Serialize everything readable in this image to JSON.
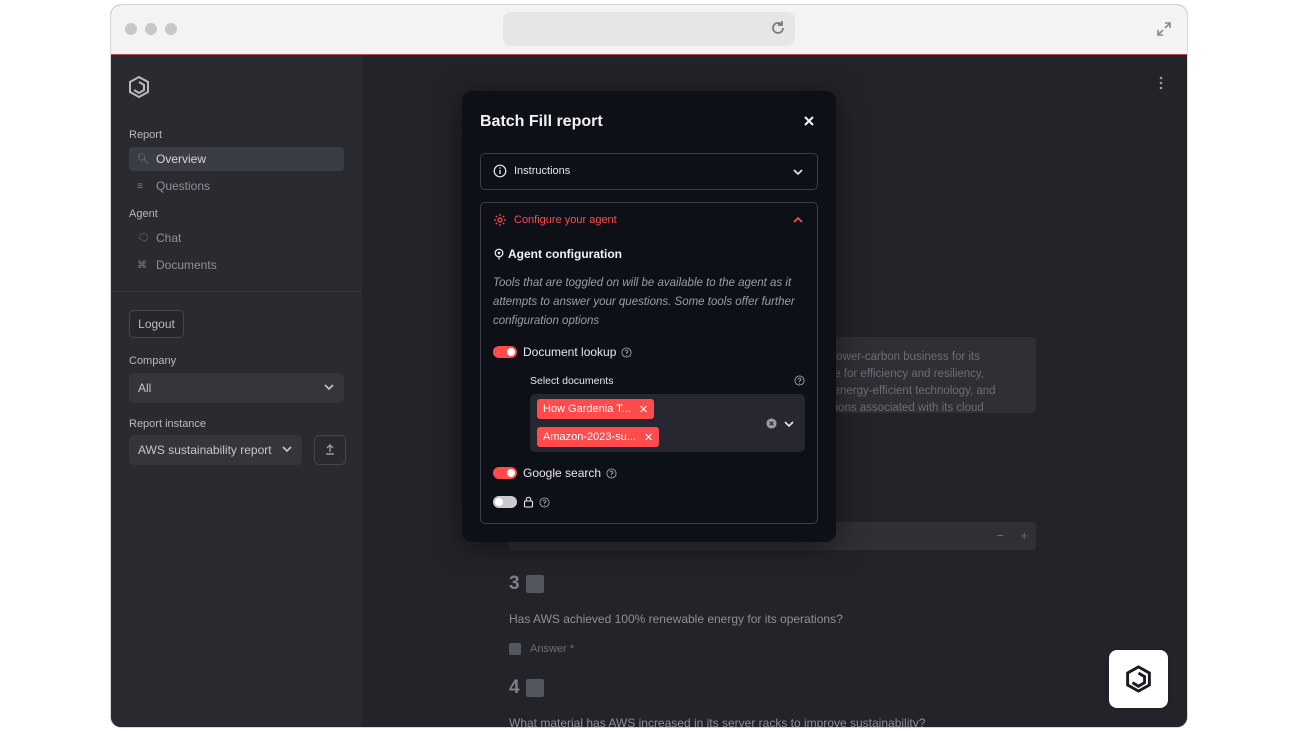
{
  "sidebar": {
    "report_label": "Report",
    "nav_overview": "Overview",
    "nav_questions": "Questions",
    "agent_label": "Agent",
    "nav_chat": "Chat",
    "nav_documents": "Documents",
    "logout": "Logout",
    "company_label": "Company",
    "company_value": "All",
    "report_instance_label": "Report instance",
    "report_instance_value": "AWS sustainability report"
  },
  "background": {
    "textarea_lines": [
      "a lower-carbon business for its",
      "are for efficiency and resiliency,",
      "n energy-efficient technology, and",
      "ssions associated with its cloud"
    ],
    "stepper_minus": "−",
    "stepper_plus": "+",
    "questions": [
      {
        "number": "3",
        "text": "Has AWS achieved 100% renewable energy for its operations?",
        "answer_label": "Answer *"
      },
      {
        "number": "4",
        "text": "What material has AWS increased in its server racks to improve sustainability?"
      }
    ]
  },
  "modal": {
    "title": "Batch Fill report",
    "instructions_label": "Instructions",
    "configure_label": "Configure your agent",
    "agent_config_title": "Agent configuration",
    "agent_config_desc": "Tools that are toggled on will be available to the agent as it attempts to answer your questions. Some tools offer further configuration options",
    "document_lookup_label": "Document lookup",
    "select_documents_label": "Select documents",
    "selected_documents": [
      "How Gardenia T...",
      "Amazon-2023-su..."
    ],
    "google_search_label": "Google search",
    "toggles": {
      "document_lookup": true,
      "google_search": true,
      "locked_tool": false
    }
  },
  "colors": {
    "accent": "#ff4b4b",
    "modal_bg": "#0d1017",
    "sidebar_bg": "#2a2b31"
  }
}
